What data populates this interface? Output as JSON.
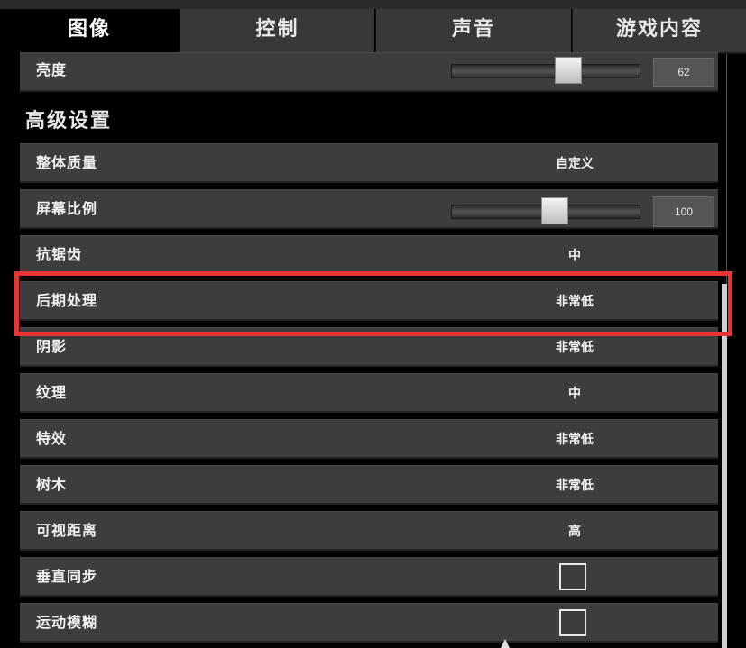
{
  "tabs": [
    {
      "label": "图像",
      "active": true
    },
    {
      "label": "控制",
      "active": false
    },
    {
      "label": "声音",
      "active": false
    },
    {
      "label": "游戏内容",
      "active": false
    }
  ],
  "brightness": {
    "label": "亮度",
    "value": "62",
    "level": 62
  },
  "advanced_title": "高级设置",
  "settings": {
    "overall_quality": {
      "label": "整体质量",
      "value": "自定义"
    },
    "screen_scale": {
      "label": "屏幕比例",
      "value": "100",
      "level": 100
    },
    "anti_aliasing": {
      "label": "抗锯齿",
      "value": "中"
    },
    "post_processing": {
      "label": "后期处理",
      "value": "非常低"
    },
    "shadows": {
      "label": "阴影",
      "value": "非常低"
    },
    "textures": {
      "label": "纹理",
      "value": "中"
    },
    "effects": {
      "label": "特效",
      "value": "非常低"
    },
    "trees": {
      "label": "树木",
      "value": "非常低"
    },
    "view_distance": {
      "label": "可视距离",
      "value": "高"
    },
    "vsync": {
      "label": "垂直同步",
      "checked": false
    },
    "motion_blur": {
      "label": "运动模糊",
      "checked": false
    }
  },
  "colors": {
    "highlight": "#e53535",
    "row_bg": "#3d3d3d",
    "background": "#000000"
  }
}
